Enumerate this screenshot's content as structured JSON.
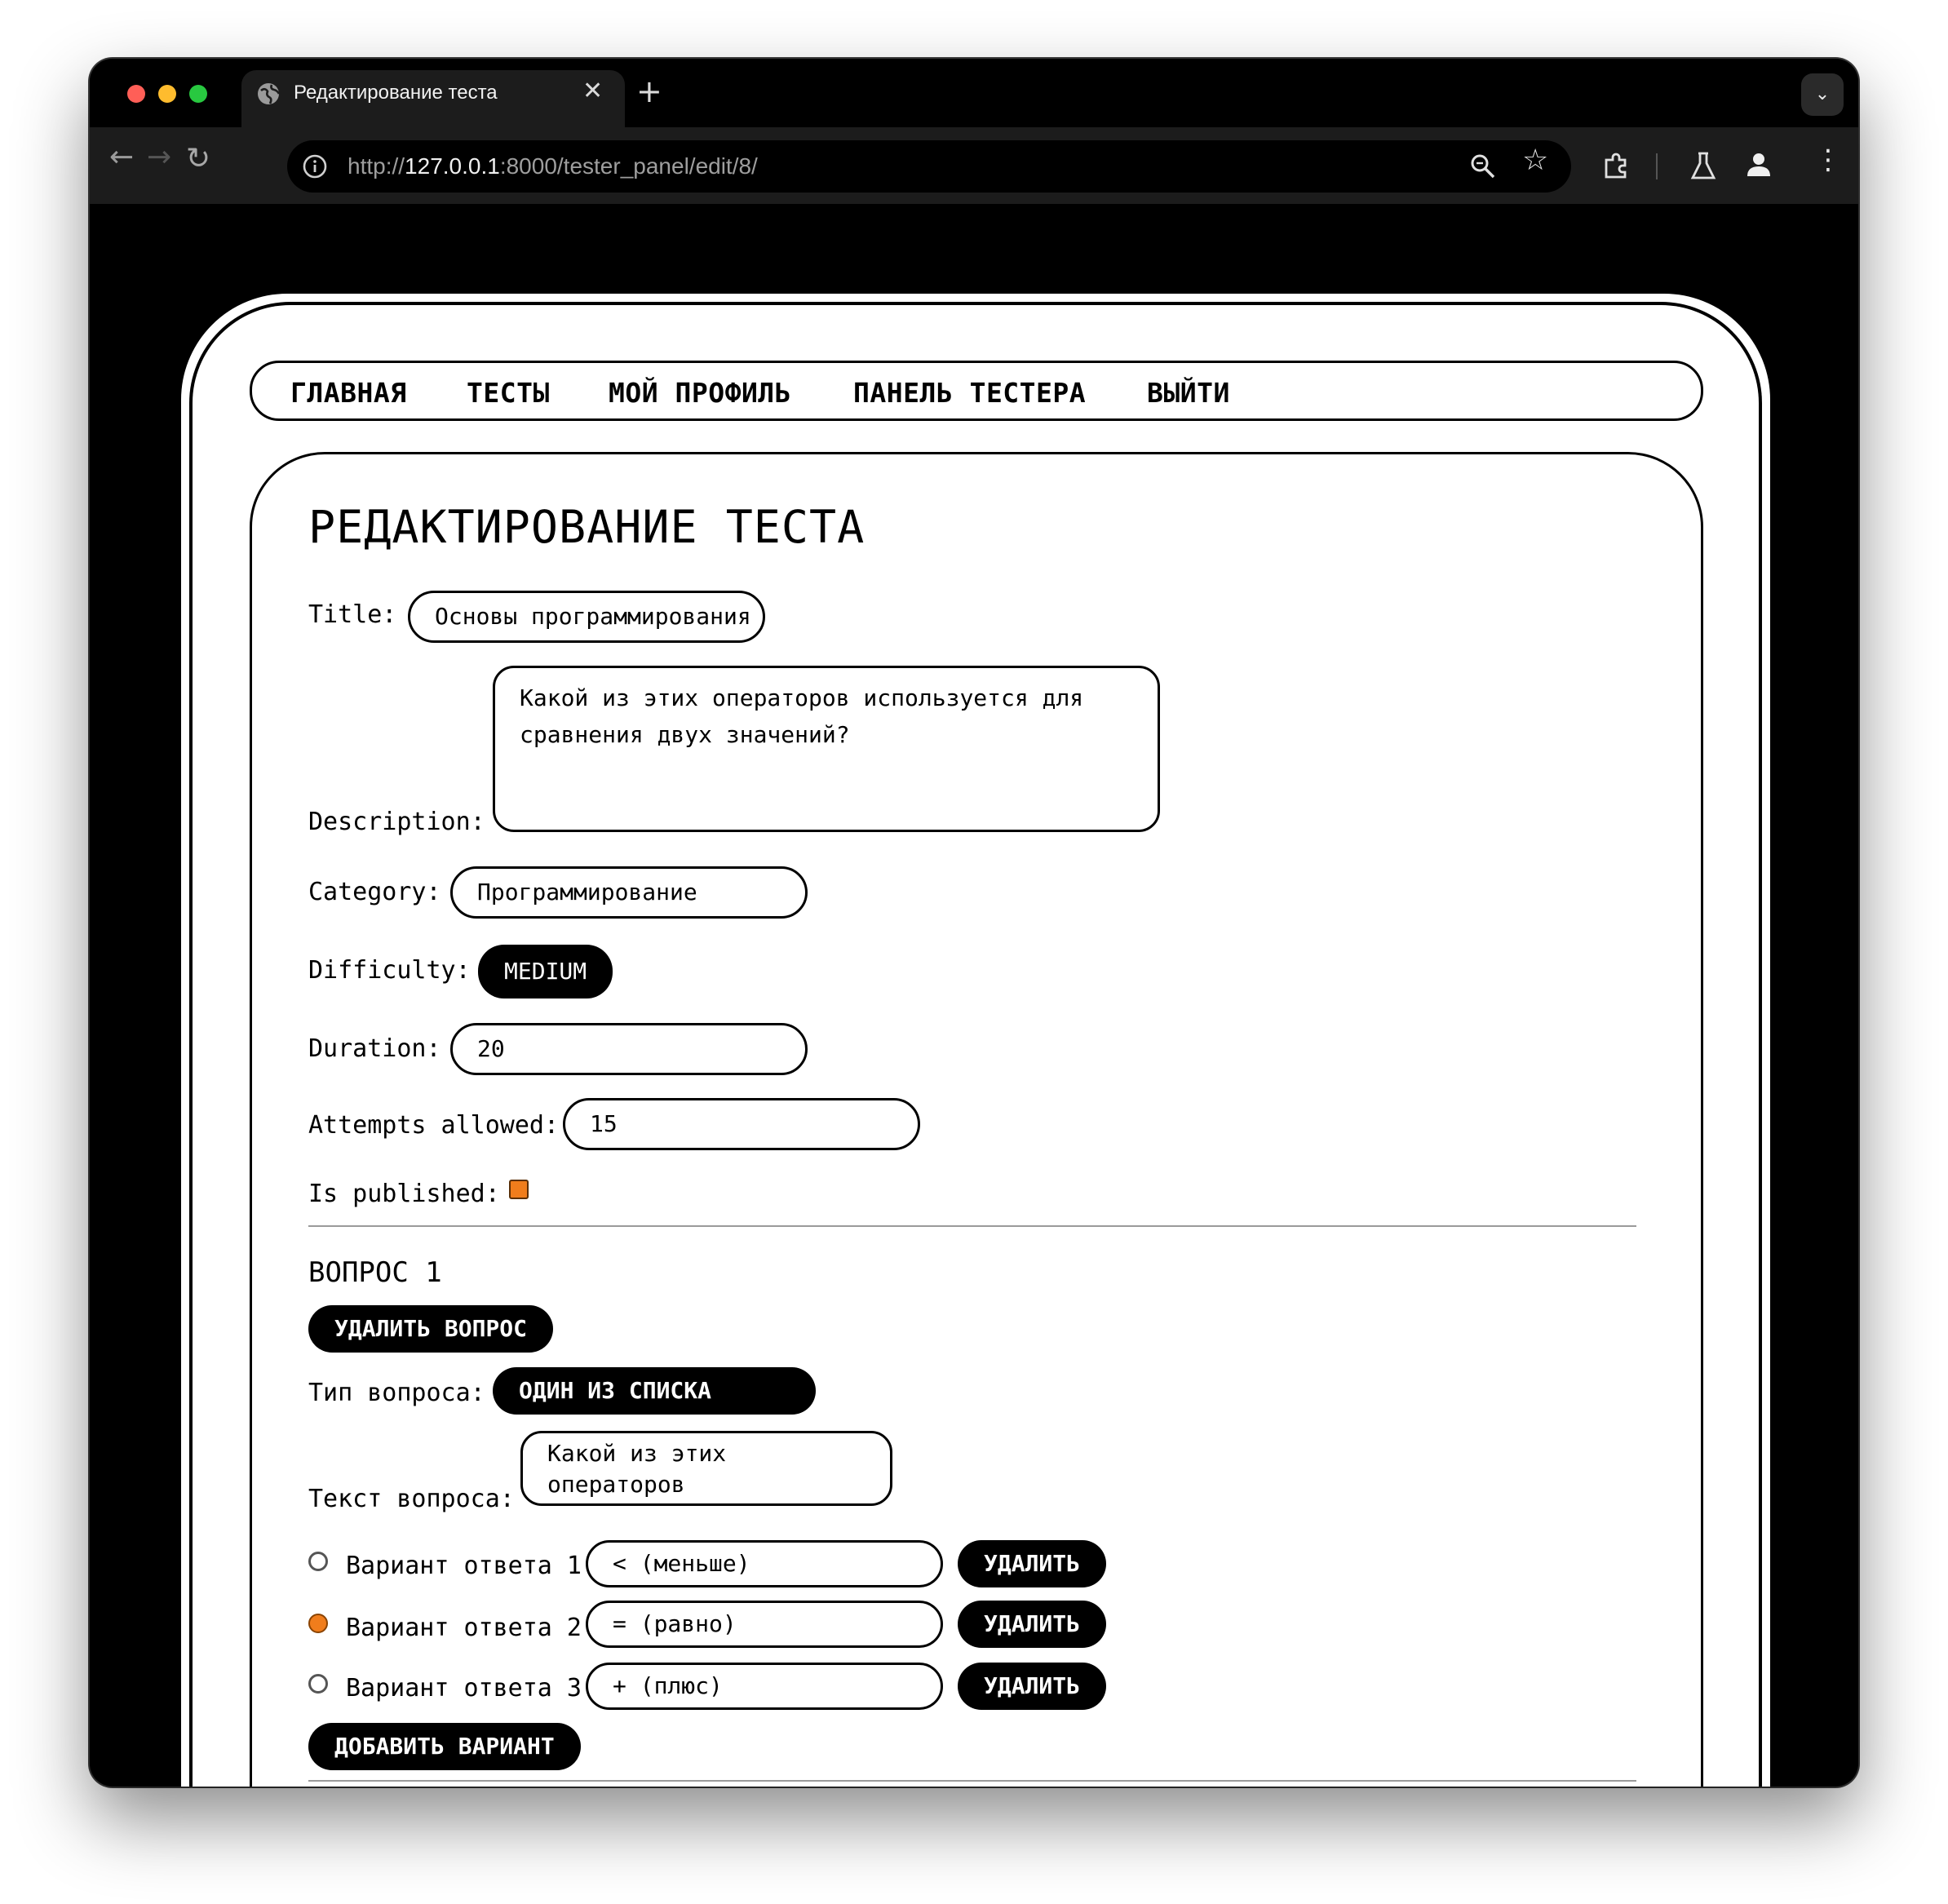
{
  "browser": {
    "tab_title": "Редактирование теста",
    "url_prefix": "http://",
    "url_host": "127.0.0.1",
    "url_rest": ":8000/tester_panel/edit/8/",
    "traffic_lights": [
      "#ff5f57",
      "#febc2e",
      "#28c840"
    ]
  },
  "nav": {
    "items": [
      "ГЛАВНАЯ",
      "ТЕСТЫ",
      "МОЙ ПРОФИЛЬ",
      "ПАНЕЛЬ ТЕСТЕРА",
      "ВЫЙТИ"
    ]
  },
  "page": {
    "title": "РЕДАКТИРОВАНИЕ ТЕСТА"
  },
  "form": {
    "title_label": "Title:",
    "title_value": "Основы программирования",
    "description_label": "Description:",
    "description_value": "Какой из этих операторов используется для сравнения двух значений?",
    "category_label": "Category:",
    "category_value": "Программирование",
    "difficulty_label": "Difficulty:",
    "difficulty_value": "MEDIUM",
    "duration_label": "Duration:",
    "duration_value": "20",
    "attempts_label": "Attempts allowed:",
    "attempts_value": "15",
    "published_label": "Is published:",
    "published_checked": true
  },
  "question": {
    "heading": "ВОПРОС 1",
    "delete_label": "УДАЛИТЬ ВОПРОС",
    "type_label": "Тип вопроса:",
    "type_value": "ОДИН ИЗ СПИСКА",
    "text_label": "Текст вопроса:",
    "text_value": "Какой из этих операторов",
    "options": [
      {
        "label": "Вариант ответа 1",
        "value": "< (меньше)",
        "selected": false,
        "delete_label": "УДАЛИТЬ"
      },
      {
        "label": "Вариант ответа 2",
        "value": "= (равно)",
        "selected": true,
        "delete_label": "УДАЛИТЬ"
      },
      {
        "label": "Вариант ответа 3",
        "value": "+ (плюс)",
        "selected": false,
        "delete_label": "УДАЛИТЬ"
      }
    ],
    "add_option_label": "ДОБАВИТЬ ВАРИАНТ"
  },
  "colors": {
    "accent": "#f07d1c",
    "ink": "#000000"
  }
}
